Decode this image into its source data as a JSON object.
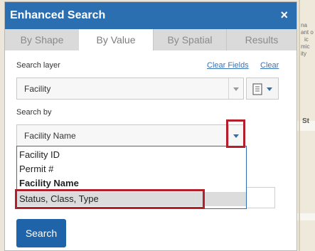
{
  "window": {
    "title": "Enhanced Search",
    "close": "×"
  },
  "tabs": [
    {
      "label": "By Shape"
    },
    {
      "label": "By Value"
    },
    {
      "label": "By Spatial"
    },
    {
      "label": "Results"
    }
  ],
  "active_tab": "By Value",
  "form": {
    "search_layer_label": "Search layer",
    "clear_fields": "Clear Fields",
    "clear": "Clear",
    "layer_value": "Facility",
    "search_by_label": "Search by",
    "search_by_value": "Facility Name",
    "options": [
      {
        "label": "Facility ID"
      },
      {
        "label": "Permit #"
      },
      {
        "label": "Facility Name"
      },
      {
        "label": "Status, Class, Type"
      }
    ],
    "selected_option": "Facility Name",
    "highlighted_option": "Status, Class, Type",
    "search_button": "Search"
  },
  "map_fragments": {
    "right_text": [
      "na",
      "ant o",
      "ic",
      "mic",
      "ity"
    ],
    "street": "St"
  },
  "colors": {
    "title_bar": "#2c6fb0",
    "search_button": "#1f63a8",
    "annotation": "#b3202c"
  }
}
